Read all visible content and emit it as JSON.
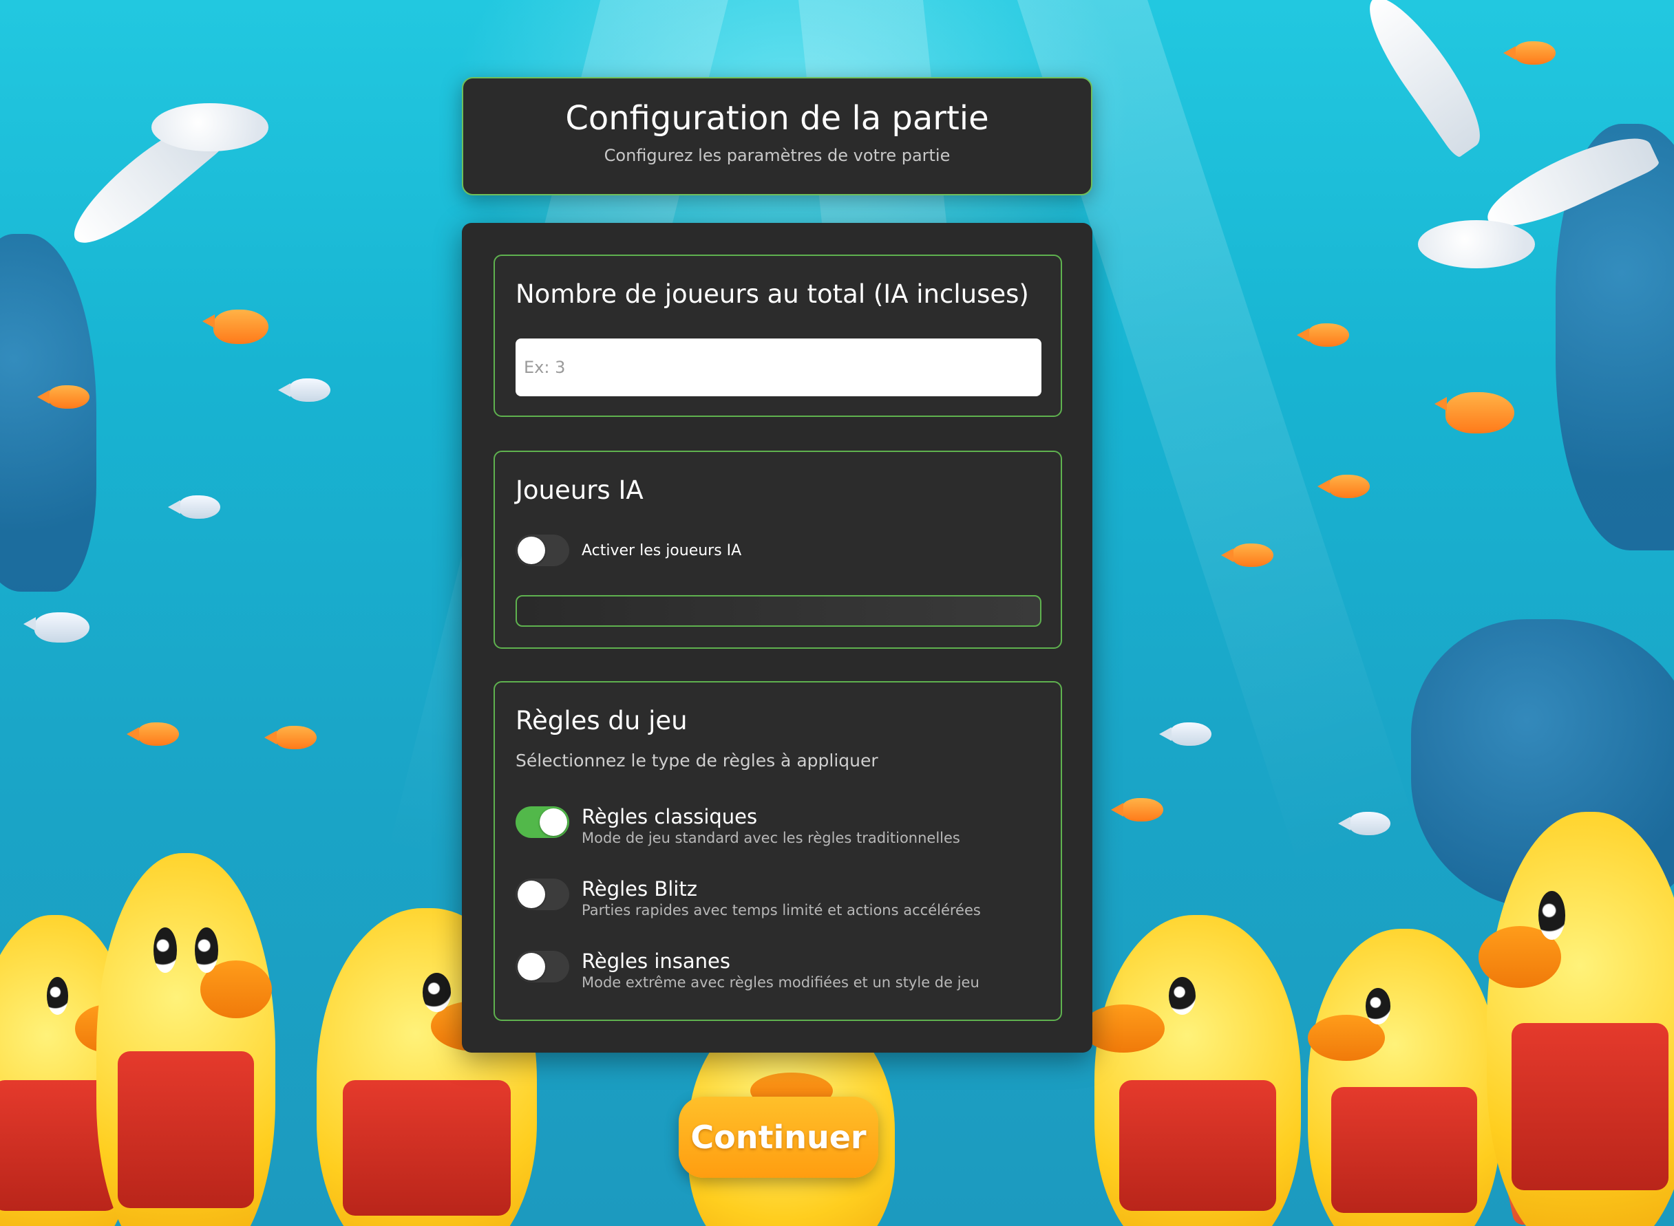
{
  "header": {
    "title": "Configuration de la partie",
    "subtitle": "Configurez les paramètres de votre partie"
  },
  "players": {
    "title": "Nombre de joueurs au total (IA incluses)",
    "value": "",
    "placeholder": "Ex: 3"
  },
  "ai": {
    "title": "Joueurs IA",
    "toggle_label": "Activer les joueurs IA",
    "enabled": false
  },
  "rules": {
    "title": "Règles du jeu",
    "description": "Sélectionnez le type de règles à appliquer",
    "options": [
      {
        "label": "Règles classiques",
        "description": "Mode de jeu standard avec les règles traditionnelles",
        "enabled": true
      },
      {
        "label": "Règles Blitz",
        "description": "Parties rapides avec temps limité et actions accélérées",
        "enabled": false
      },
      {
        "label": "Règles insanes",
        "description": "Mode extrême avec règles modifiées et un style de jeu",
        "enabled": false
      }
    ]
  },
  "actions": {
    "continue_label": "Continuer"
  },
  "colors": {
    "accent": "#5fb24f",
    "toggle_on": "#52b84a",
    "button": "#ffa816",
    "panel": "#2a2a2a"
  }
}
